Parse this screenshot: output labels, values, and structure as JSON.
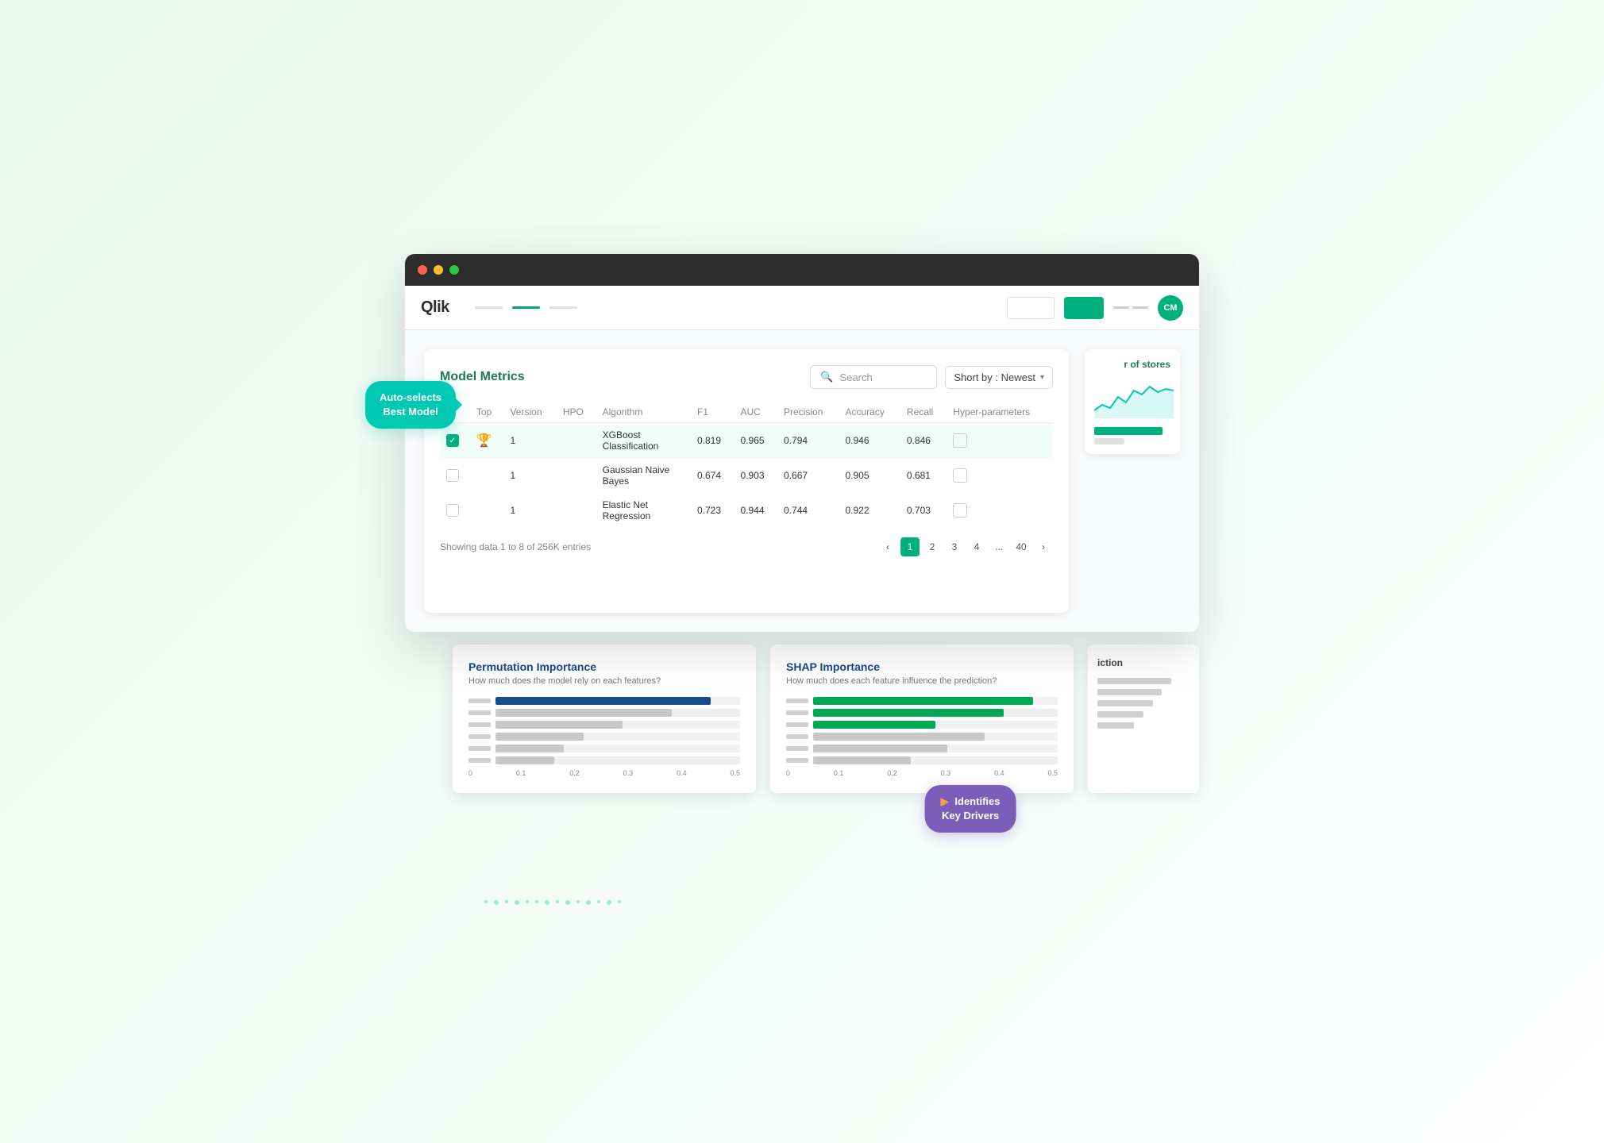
{
  "app": {
    "brand": "Qlik",
    "avatar_initials": "CM",
    "avatar_color": "#00b07c",
    "nav_green_btn_color": "#00b07c"
  },
  "browser": {
    "traffic_lights": [
      "red",
      "yellow",
      "green"
    ]
  },
  "model_metrics": {
    "title": "Model Metrics",
    "search_placeholder": "Search",
    "sort_label": "Short by : Newest",
    "table": {
      "columns": [
        "Top",
        "Version",
        "HPO",
        "Algorithm",
        "F1",
        "AUC",
        "Precision",
        "Accuracy",
        "Recall",
        "Hyper-parameters"
      ],
      "rows": [
        {
          "selected": true,
          "top_icon": "trophy",
          "version": "1",
          "hpo": "",
          "algorithm": "XGBoost Classification",
          "f1": "0.819",
          "auc": "0.965",
          "precision": "0.794",
          "accuracy": "0.946",
          "recall": "0.846",
          "highlighted": true
        },
        {
          "selected": false,
          "top_icon": "",
          "version": "1",
          "hpo": "",
          "algorithm": "Gaussian Naive Bayes",
          "f1": "0.674",
          "auc": "0.903",
          "precision": "0.667",
          "accuracy": "0.905",
          "recall": "0.681",
          "highlighted": false
        },
        {
          "selected": false,
          "top_icon": "",
          "version": "1",
          "hpo": "",
          "algorithm": "Elastic Net Regression",
          "f1": "0.723",
          "auc": "0.944",
          "precision": "0.744",
          "accuracy": "0.922",
          "recall": "0.703",
          "highlighted": false
        }
      ]
    },
    "pagination": {
      "showing_text": "Showing data 1 to 8 of  256K entries",
      "pages": [
        "1",
        "2",
        "3",
        "4",
        "...",
        "40"
      ],
      "current_page": "1"
    }
  },
  "right_chart": {
    "stores_label": "r of stores",
    "green_bar_width": "90%",
    "gray_bar_width": "40%"
  },
  "permutation": {
    "title": "Permutation Importance",
    "subtitle": "How much does the model rely on each features?",
    "bars": [
      {
        "width": "88%",
        "color": "blue"
      },
      {
        "width": "72%",
        "color": "light-gray"
      },
      {
        "width": "52%",
        "color": "light-gray"
      },
      {
        "width": "36%",
        "color": "light-gray"
      },
      {
        "width": "28%",
        "color": "light-gray"
      },
      {
        "width": "24%",
        "color": "light-gray"
      }
    ],
    "axis": [
      "0",
      "0.1",
      "0.2",
      "0.3",
      "0.4",
      "0.5"
    ]
  },
  "shap": {
    "title": "SHAP Importance",
    "subtitle": "How much does each feature influence the prediction?",
    "bars": [
      {
        "width": "90%",
        "color": "green"
      },
      {
        "width": "78%",
        "color": "green"
      },
      {
        "width": "50%",
        "color": "green"
      },
      {
        "width": "70%",
        "color": "light-gray"
      },
      {
        "width": "55%",
        "color": "light-gray"
      },
      {
        "width": "40%",
        "color": "light-gray"
      }
    ],
    "axis": [
      "0",
      "0.1",
      "0.2",
      "0.3",
      "0.4",
      "0.5"
    ]
  },
  "callouts": {
    "auto_select": "Auto-selects\nBest Model",
    "identifies_drivers": "Identifies\nKey Drivers"
  }
}
